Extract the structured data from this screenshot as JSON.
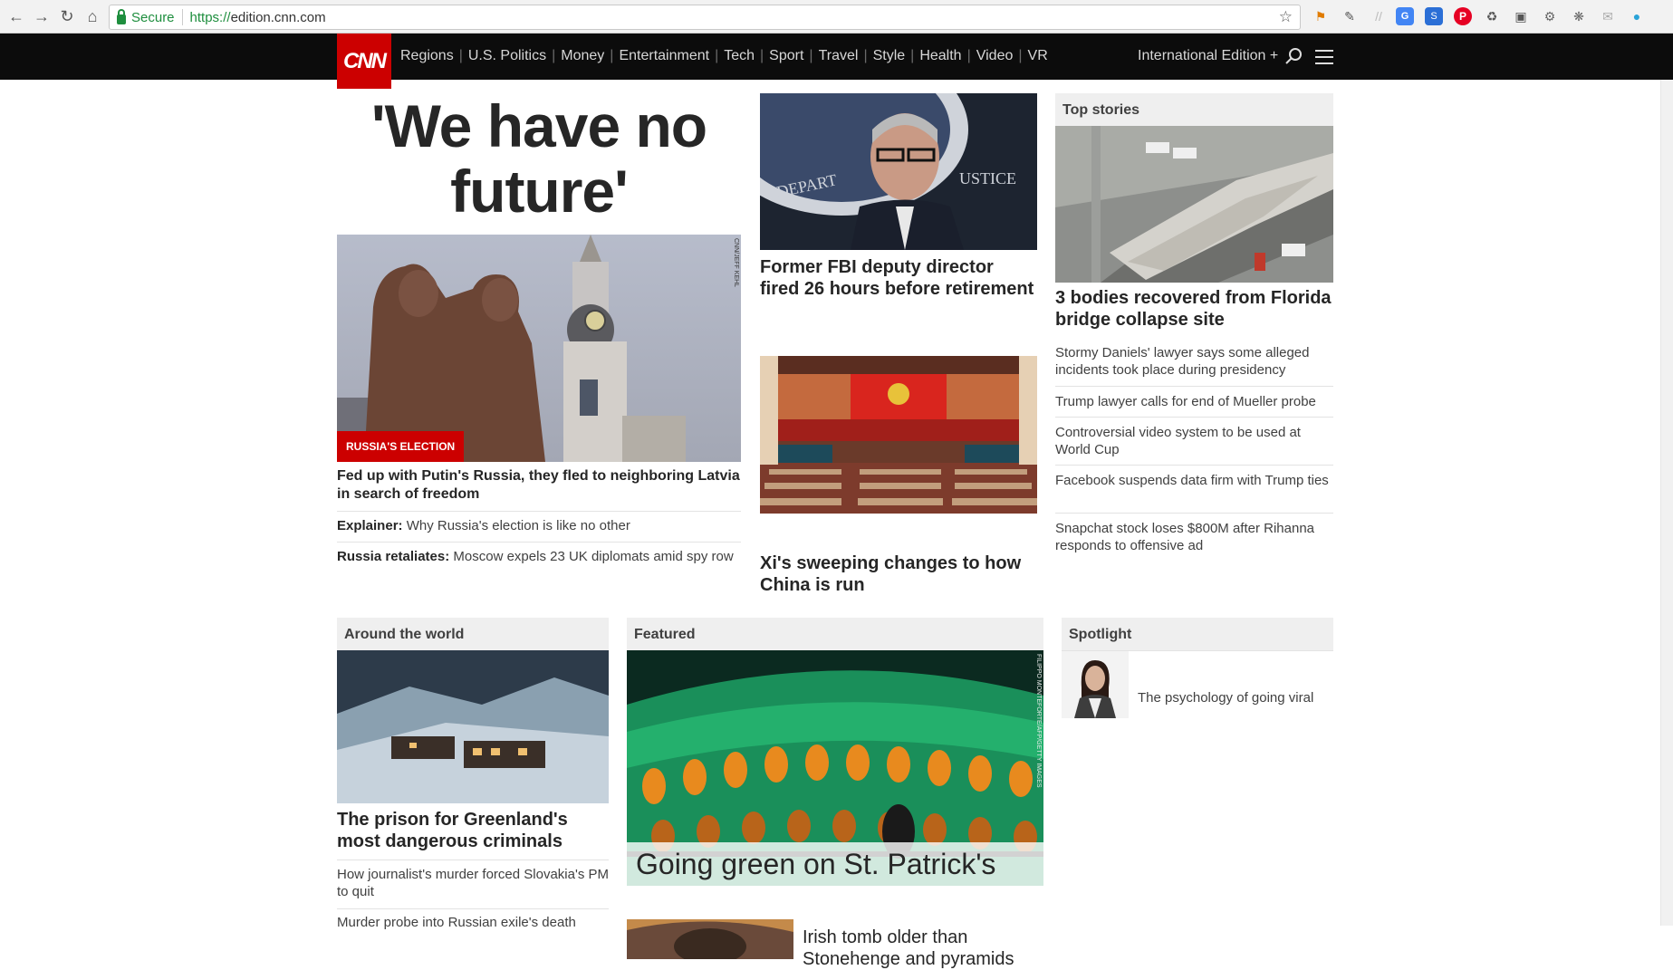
{
  "browser": {
    "secure_label": "Secure",
    "url_scheme": "https://",
    "url_rest": "edition.cnn.com",
    "extensions": [
      "bookmark-icon",
      "eyedropper-icon",
      "translate-icon",
      "screenshot-icon",
      "pinterest-icon",
      "recycle-icon",
      "fullscreen-icon",
      "globe-icon",
      "settings-icon",
      "mail-icon",
      "color-icon"
    ]
  },
  "site": {
    "logo": "CNN",
    "nav": [
      "Regions",
      "U.S. Politics",
      "Money",
      "Entertainment",
      "Tech",
      "Sport",
      "Travel",
      "Style",
      "Health",
      "Video",
      "VR"
    ],
    "edition": "International Edition +"
  },
  "lead": {
    "headline_line1": "'We have no",
    "headline_line2": "future'",
    "image_credit": "CNN/JEFF KEHL",
    "badge": "RUSSIA'S ELECTION",
    "title": "Fed up with Putin's Russia, they fled to neighboring Latvia in search of freedom",
    "sub1_label": "Explainer:",
    "sub1_text": "Why Russia's election is like no other",
    "sub2_label": "Russia retaliates:",
    "sub2_text": "Moscow expels 23 UK diplomats amid spy row"
  },
  "middle": {
    "story1": "Former FBI deputy director fired 26 hours before retirement",
    "story2": "Xi's sweeping changes to how China is run"
  },
  "top_stories": {
    "header": "Top stories",
    "main": "3 bodies recovered from Florida bridge collapse site",
    "items": [
      "Stormy Daniels' lawyer says some alleged incidents took place during presidency",
      "Trump lawyer calls for end of Mueller probe",
      "Controversial video system to be used at World Cup",
      "Facebook suspends data firm with Trump ties",
      "Snapchat stock loses $800M after Rihanna responds to offensive ad"
    ]
  },
  "around": {
    "header": "Around the world",
    "main": "The prison for Greenland's most dangerous criminals",
    "item1": "How journalist's murder forced Slovakia's PM to quit",
    "item2": "Murder probe into Russian exile's death"
  },
  "featured": {
    "header": "Featured",
    "overlay": "Going green on St. Patrick's Day",
    "credit": "FILIPPO MONTEFORTE/AFP/GETTY IMAGES",
    "item1": "Irish tomb older than Stonehenge and pyramids"
  },
  "spotlight": {
    "header": "Spotlight",
    "item1": "The psychology of going viral"
  }
}
